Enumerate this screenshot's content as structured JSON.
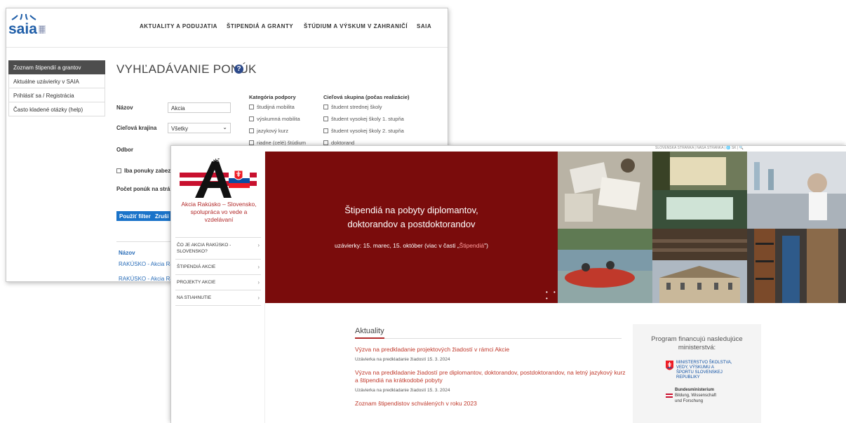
{
  "saia": {
    "logo_text": "saia",
    "nav": [
      "AKTUALITY A PODUJATIA",
      "ŠTIPENDIÁ A GRANTY",
      "ŠTÚDIUM A VÝSKUM V ZAHRANIČÍ",
      "SAIA"
    ],
    "sidebar": [
      "Zoznam štipendií a grantov",
      "Aktuálne uzávierky v SAIA",
      "Prihlásiť sa / Registrácia",
      "Často kladené otázky (help)"
    ],
    "page_title": "VYHĽADÁVANIE PONÚK",
    "help_glyph": "?",
    "form": {
      "name_label": "Názov",
      "name_value": "Akcia",
      "country_label": "Cieľová krajina",
      "country_value": "Všetky",
      "field_label": "Odbor",
      "only_label": "Iba ponuky zabez",
      "count_label": "Počet ponúk na strá",
      "filter_button": "Použiť filter",
      "reset_button": "Zruši"
    },
    "category": {
      "title": "Kategória podpory",
      "options": [
        "študijná mobilita",
        "výskumná mobilita",
        "jazykový kurz",
        "riadne (celé) štúdium"
      ]
    },
    "target_group": {
      "title": "Cieľová skupina (počas realizácie)",
      "options": [
        "študent strednej školy",
        "študent vysokej školy 1. stupňa",
        "študent vysokej školy 2. stupňa",
        "doktorand"
      ]
    },
    "results": {
      "header": "Názov",
      "rows": [
        "RAKÚSKO - Akcia Ra",
        "RAKÚSKO - Akcia Ra"
      ]
    }
  },
  "aktion": {
    "topbar": "SLOVENSKÁ STRÁNKA  |  NÁŠA STRÁNKA  |  🌐 SK  |  🔍",
    "logo_word": "Aktion",
    "tagline": "Akcia Rakúsko – Slovensko, spolupráca vo vede a vzdelávaní",
    "menu": [
      {
        "label": "ČO JE AKCIA RAKÚSKO - SLOVENSKO?"
      },
      {
        "label": "ŠTIPENDIÁ AKCIE"
      },
      {
        "label": "PROJEKTY AKCIE"
      },
      {
        "label": "NA STIAHNUTIE"
      }
    ],
    "hero": {
      "line1": "Štipendiá na pobyty diplomantov,",
      "line2": "doktorandov a postdoktorandov",
      "deadline_prefix": "uzávierky: 15. marec, 15. október (viac v časti „",
      "deadline_link": "Štipendiá",
      "deadline_suffix": "\")",
      "dots": "• • •"
    },
    "news": {
      "title": "Aktuality",
      "items": [
        {
          "title": "Výzva na predkladanie projektových žiadostí v rámci Akcie",
          "date": "Uzávierka na predkladanie žiadostí 15. 3. 2024"
        },
        {
          "title": "Výzva na predkladanie žiadostí pre diplomantov, doktorandov, postdoktorandov, na letný jazykový kurz a štipendiá na krátkodobé pobyty",
          "date": "Uzávierka na predkladanie žiadostí 15. 3. 2024"
        },
        {
          "title": "Zoznam štipendistov schválených v roku 2023",
          "date": ""
        }
      ]
    },
    "funding": {
      "title": "Program financujú nasledujúce ministerstvá:",
      "sk_ministry": "MINISTERSTVO ŠKOLSTVA, VEDY, VÝSKUMU A ŠPORTU SLOVENSKEJ REPUBLIKY",
      "at_ministry_1": "Bundesministerium",
      "at_ministry_2": "Bildung, Wissenschaft",
      "at_ministry_3": "und Forschung"
    },
    "colors": {
      "hero_red": "#7a0c0c",
      "link_red": "#c0392b",
      "saia_blue": "#1a73c9"
    }
  }
}
